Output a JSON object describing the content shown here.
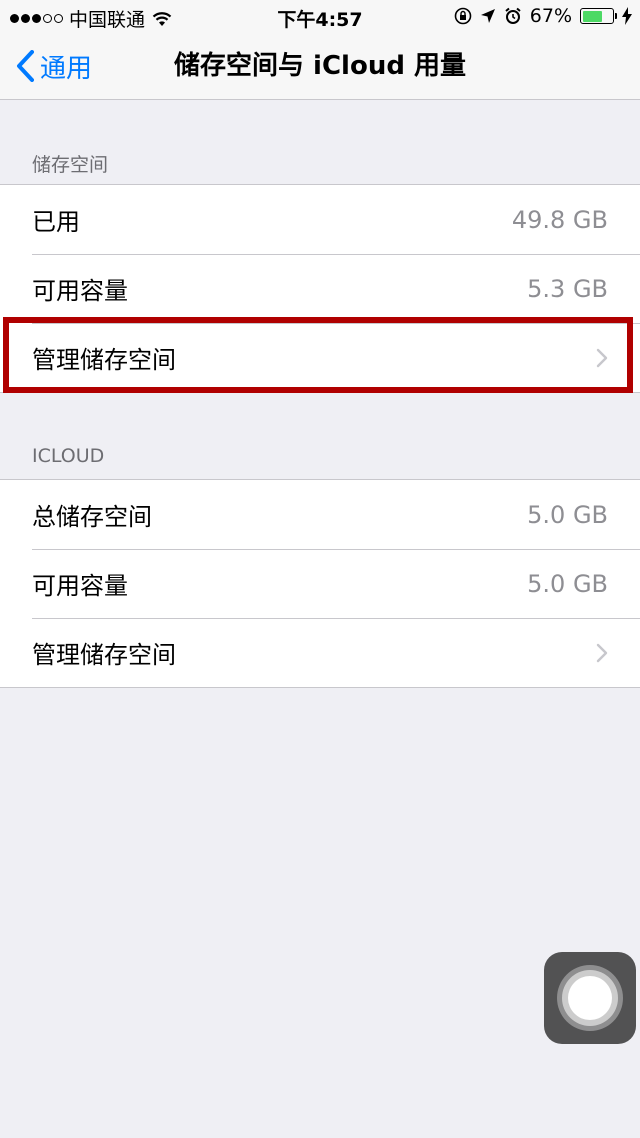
{
  "status_bar": {
    "carrier": "中国联通",
    "time": "下午4:57",
    "battery_percent": "67%",
    "battery_level": 0.67
  },
  "nav": {
    "back_label": "通用",
    "title": "储存空间与 iCloud 用量"
  },
  "storage": {
    "header": "储存空间",
    "rows": [
      {
        "label": "已用",
        "value": "49.8 GB"
      },
      {
        "label": "可用容量",
        "value": "5.3 GB"
      },
      {
        "label": "管理储存空间"
      }
    ]
  },
  "icloud": {
    "header": "ICLOUD",
    "rows": [
      {
        "label": "总储存空间",
        "value": "5.0 GB"
      },
      {
        "label": "可用容量",
        "value": "5.0 GB"
      },
      {
        "label": "管理储存空间"
      }
    ]
  },
  "colors": {
    "accent": "#007aff",
    "highlight": "#b00000",
    "battery": "#4cd964"
  }
}
